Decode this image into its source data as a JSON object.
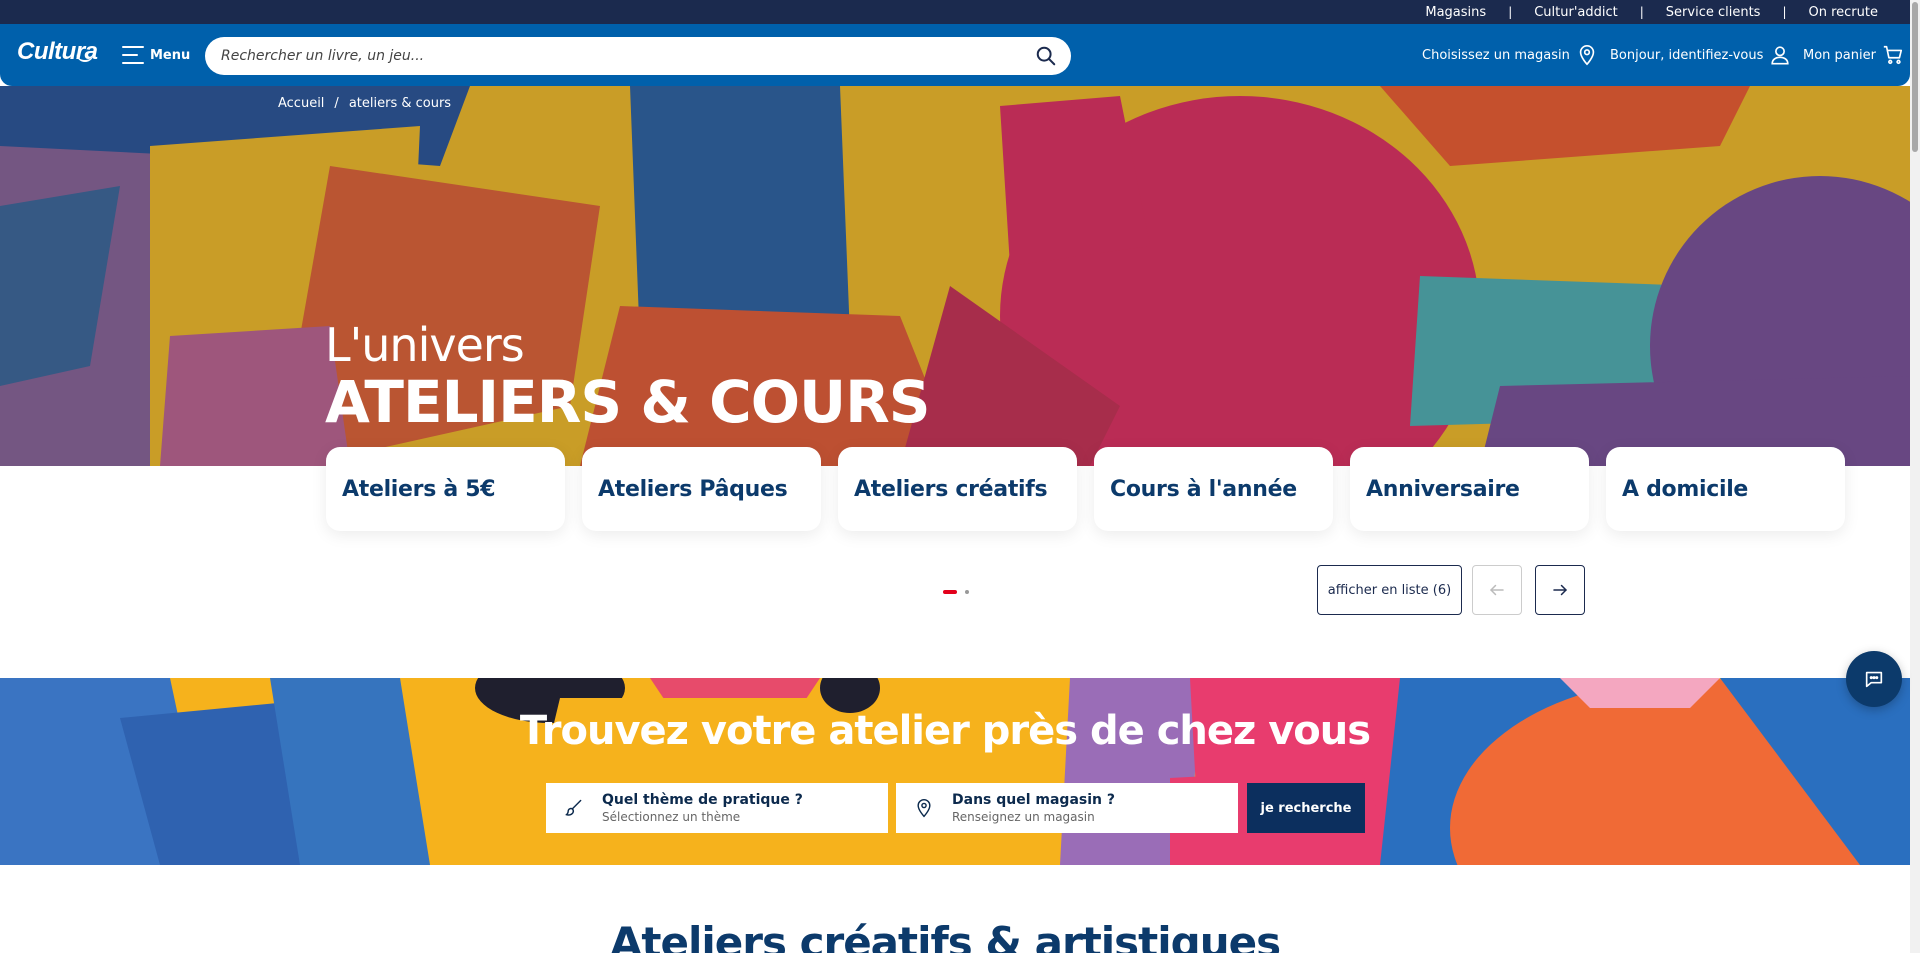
{
  "topbar": {
    "links": [
      "Magasins",
      "Cultur'addict",
      "Service clients",
      "On recrute"
    ]
  },
  "header": {
    "logo": "Cultura",
    "menu_label": "Menu",
    "search_placeholder": "Rechercher un livre, un jeu...",
    "store_label": "Choisissez un magasin",
    "account_label": "Bonjour, identifiez-vous",
    "cart_label": "Mon panier"
  },
  "breadcrumb": {
    "home": "Accueil",
    "separator": "/",
    "current": "ateliers & cours"
  },
  "hero": {
    "subtitle": "L'univers",
    "title": "ATELIERS & COURS"
  },
  "cards": [
    {
      "label": "Ateliers à 5€"
    },
    {
      "label": "Ateliers Pâques"
    },
    {
      "label": "Ateliers créatifs"
    },
    {
      "label": "Cours à l'année"
    },
    {
      "label": "Anniversaire"
    },
    {
      "label": "A domicile"
    }
  ],
  "carousel": {
    "list_button": "afficher en liste (6)",
    "pages": 2,
    "current_page": 1
  },
  "finder": {
    "title": "Trouvez votre atelier près de chez vous",
    "theme_label": "Quel thème de pratique ?",
    "theme_hint": "Sélectionnez un thème",
    "store_label": "Dans quel magasin ?",
    "store_hint": "Renseignez un magasin",
    "button": "je recherche"
  },
  "section": {
    "title": "Ateliers créatifs & artistiques"
  },
  "colors": {
    "header_blue": "#0060ab",
    "topbar_navy": "#1b2a4e",
    "accent_red": "#e3001b",
    "text_navy": "#0c3a6b"
  },
  "icons": [
    "hamburger-icon",
    "search-icon",
    "location-pin-icon",
    "user-icon",
    "cart-icon",
    "arrow-left-icon",
    "arrow-right-icon",
    "brush-icon",
    "chat-icon"
  ]
}
